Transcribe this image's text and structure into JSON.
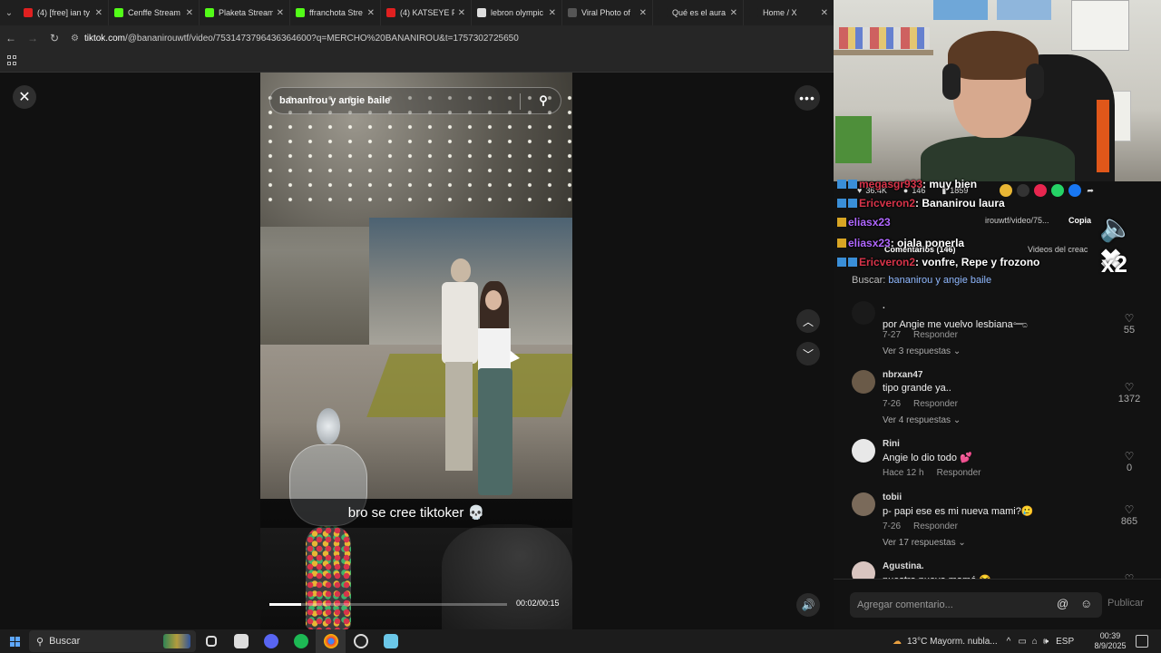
{
  "browser": {
    "tabs": [
      {
        "label": "(4) [free] ian ty",
        "color": "#e02020"
      },
      {
        "label": "Cenffe Stream",
        "color": "#53fc18"
      },
      {
        "label": "Plaketa Stream",
        "color": "#53fc18"
      },
      {
        "label": "ffranchota Stre",
        "color": "#53fc18"
      },
      {
        "label": "(4) KATSEYE Pe",
        "color": "#e02020"
      },
      {
        "label": "lebron olympic",
        "color": "#dddddd"
      },
      {
        "label": "Viral Photo of",
        "color": "#555555"
      },
      {
        "label": "Qué es el aura",
        "color": "#1f1f1f"
      },
      {
        "label": "Home / X",
        "color": "#1f1f1f"
      }
    ],
    "url_host": "tiktok.com",
    "url_path": "/@bananirouwtf/video/7531473796436364600?q=MERCHO%20BANANIROU&t=1757302725650"
  },
  "video": {
    "search_query": "bananirou y angie baile",
    "caption": "bro se cree tiktoker 💀",
    "time": "00:02/00:15",
    "progress": 0.133
  },
  "stats": {
    "likes": "36.4K",
    "comments": "146",
    "saves": "1859"
  },
  "chat": [
    {
      "user": "megasgr933",
      "message": ": muy bien",
      "user_color": "#d8344a"
    },
    {
      "user": "Ericveron2",
      "message": ": Bananirou laura",
      "user_color": "#d8344a"
    },
    {
      "user": "eliasx23",
      "message": "",
      "user_color": "#b067ff"
    },
    {
      "user": "eliasx23",
      "message": ": ojala ponerla",
      "user_color": "#b067ff"
    },
    {
      "user": "Ericveron2",
      "message": ": vonfre, Repe y frozono",
      "user_color": "#d8344a"
    }
  ],
  "overlay": {
    "url_fragment": "irouwtf/video/75...",
    "copy": "Copia",
    "comments_tab": "Comentarios (146)",
    "creator_videos": "Videos del creac",
    "x2": "x2"
  },
  "search_link": {
    "prefix": "Buscar: ",
    "query": "bananirou y angie baile"
  },
  "comments": [
    {
      "user": ".",
      "text": "por Angie me vuelvo lesbiana𓂸",
      "date": "7-27",
      "reply": "Responder",
      "replies": "Ver 3 respuestas ⌄",
      "likes": "55"
    },
    {
      "user": "nbrxan47",
      "text": "tipo grande ya..",
      "date": "7-26",
      "reply": "Responder",
      "replies": "Ver 4 respuestas ⌄",
      "likes": "1372"
    },
    {
      "user": "Rini",
      "text": "Angie lo dio todo 💕",
      "date": "Hace 12 h",
      "reply": "Responder",
      "replies": "",
      "likes": "0"
    },
    {
      "user": "tobii",
      "text": "p- papi ese es mi nueva mami?🥲",
      "date": "7-26",
      "reply": "Responder",
      "replies": "Ver 17 respuestas ⌄",
      "likes": "865"
    },
    {
      "user": "Agustina.",
      "text": "nuestra nueva mamá 😂",
      "date": "",
      "reply": "",
      "replies": "",
      "likes": ""
    }
  ],
  "add_comment": {
    "placeholder": "Agregar comentario...",
    "publish": "Publicar"
  },
  "taskbar": {
    "search": "Buscar",
    "weather": "13°C  Mayorm. nubla...",
    "lang": "ESP",
    "time": "00:39",
    "date": "8/9/2025"
  }
}
